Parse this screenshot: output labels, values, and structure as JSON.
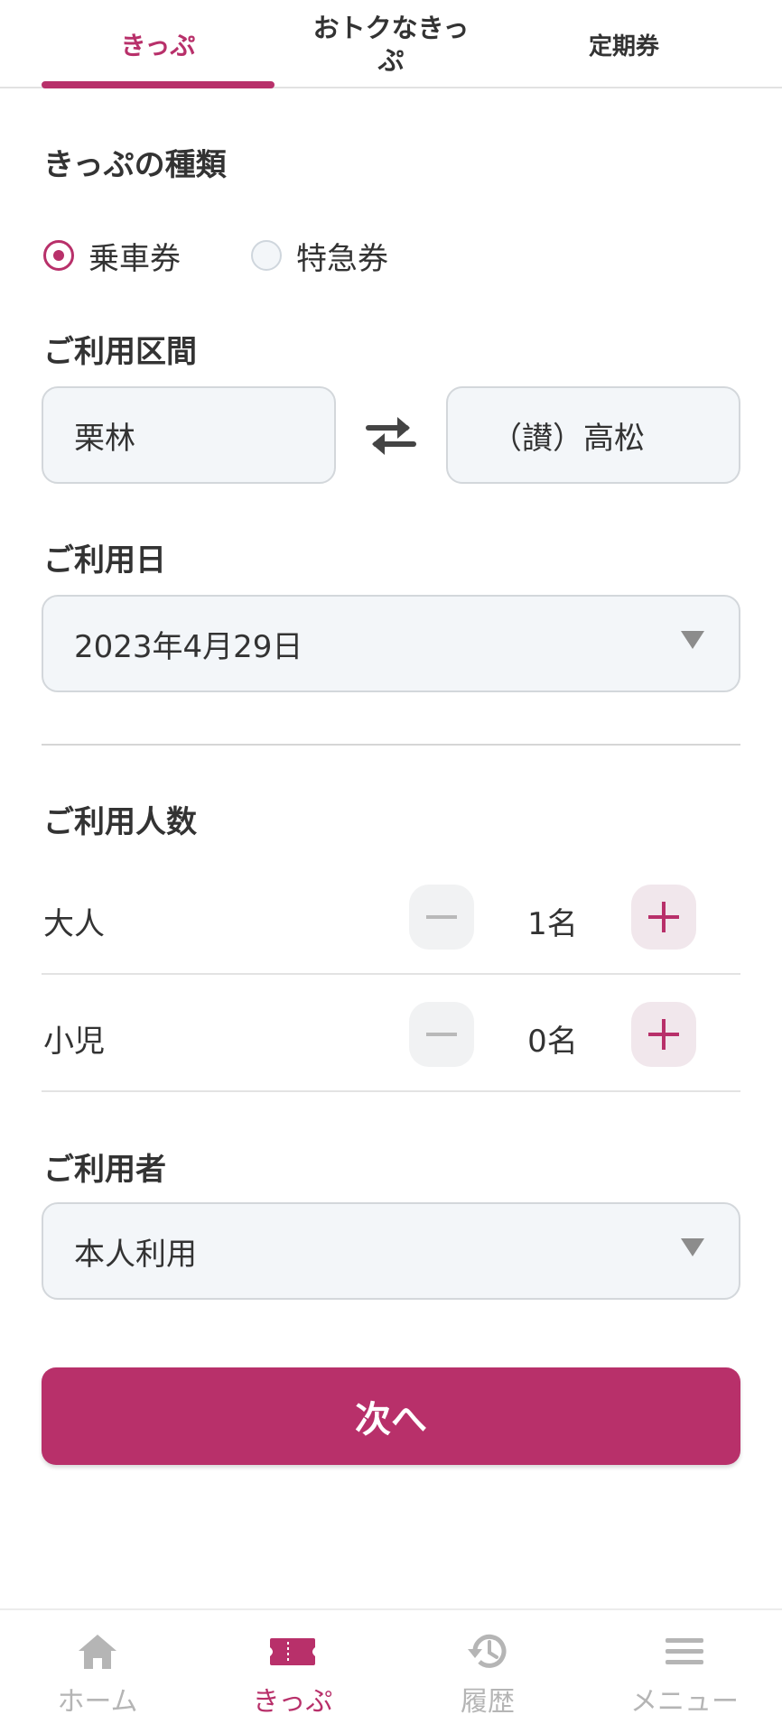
{
  "tabs": [
    {
      "label": "きっぷ"
    },
    {
      "label": "おトクなきっぷ"
    },
    {
      "label": "定期券"
    }
  ],
  "ticket_type": {
    "title": "きっぷの種類",
    "options": [
      {
        "label": "乗車券",
        "selected": true
      },
      {
        "label": "特急券",
        "selected": false
      }
    ]
  },
  "route": {
    "title": "ご利用区間",
    "from": "栗林",
    "to": "（讃）高松"
  },
  "date": {
    "title": "ご利用日",
    "value": "2023年4月29日"
  },
  "passengers": {
    "title": "ご利用人数",
    "rows": [
      {
        "label": "大人",
        "count": "1名"
      },
      {
        "label": "小児",
        "count": "0名"
      }
    ]
  },
  "user": {
    "title": "ご利用者",
    "value": "本人利用"
  },
  "next_label": "次へ",
  "bottom_nav": [
    {
      "label": "ホーム",
      "icon": "home-icon"
    },
    {
      "label": "きっぷ",
      "icon": "ticket-icon"
    },
    {
      "label": "履歴",
      "icon": "history-icon"
    },
    {
      "label": "メニュー",
      "icon": "menu-icon"
    }
  ],
  "colors": {
    "accent": "#b8306a",
    "field_bg": "#f3f6f9",
    "inactive": "#b5b5b5"
  }
}
